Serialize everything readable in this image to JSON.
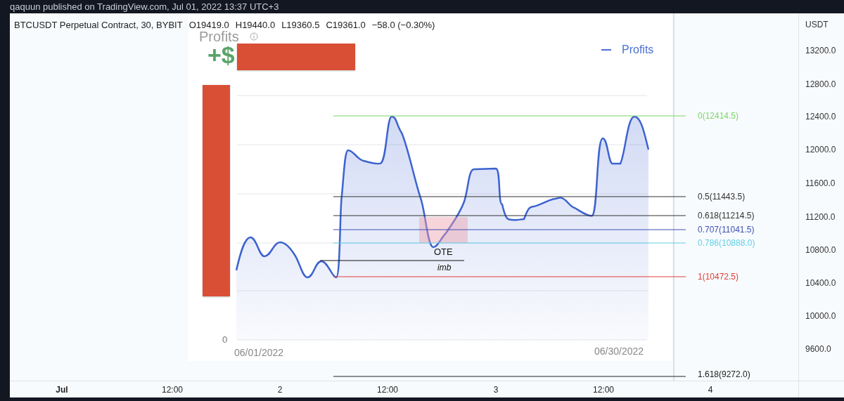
{
  "header": {
    "text": "qaquun published on TradingView.com, Jul 01, 2022 13:37 UTC+3"
  },
  "legend": {
    "items": [
      "BTCUSDT Perpetual Contract, 30, BYBIT",
      "O19419.0",
      "H19440.0",
      "L19360.5",
      "C19361.0",
      "−58.0 (−0.30%)"
    ]
  },
  "screenshot": {
    "title": "Profits",
    "prefix": "+$",
    "legend": "Profits",
    "y_zero": "0",
    "date_start": "06/01/2022",
    "date_end": "06/30/2022"
  },
  "fib_levels": [
    {
      "label": "0(12414.5)",
      "color": "#7ad66b"
    },
    {
      "label": "0.5(11443.5)",
      "color": "#333333"
    },
    {
      "label": "0.618(11214.5)",
      "color": "#333333"
    },
    {
      "label": "0.707(11041.5)",
      "color": "#3f51b5"
    },
    {
      "label": "0.786(10888.0)",
      "color": "#5fd0e8"
    },
    {
      "label": "1(10472.5)",
      "color": "#e0403a"
    },
    {
      "label": "1.618(9272.0)",
      "color": "#222222"
    }
  ],
  "ote_box": {
    "label": "OTE"
  },
  "imbalance": {
    "label": "imb"
  },
  "price_axis": {
    "currency": "USDT",
    "labels": [
      "13200.0",
      "12800.0",
      "12400.0",
      "12000.0",
      "11600.0",
      "11200.0",
      "10800.0",
      "10400.0",
      "10000.0",
      "9600.0"
    ]
  },
  "time_axis": {
    "labels": [
      {
        "text": "Jul",
        "bold": true
      },
      {
        "text": "12:00",
        "bold": false
      },
      {
        "text": "2",
        "bold": false
      },
      {
        "text": "12:00",
        "bold": false
      },
      {
        "text": "3",
        "bold": false
      },
      {
        "text": "12:00",
        "bold": false
      },
      {
        "text": "4",
        "bold": false
      }
    ]
  }
}
